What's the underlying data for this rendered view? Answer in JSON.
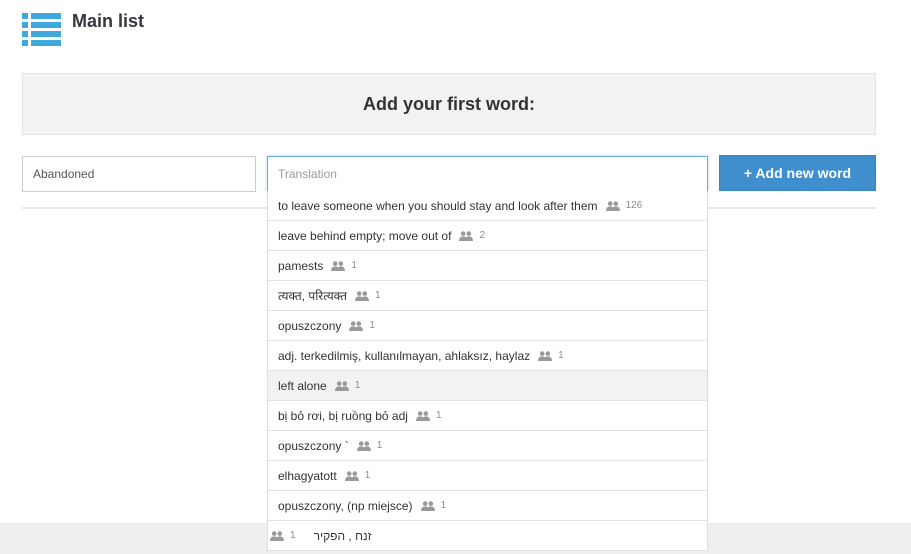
{
  "header": {
    "title": "Main list",
    "icon": "list-icon"
  },
  "add_panel": {
    "heading": "Add your first word:"
  },
  "form": {
    "word_value": "Abandoned",
    "translation_value": "",
    "translation_placeholder": "Translation",
    "add_button_label": "+ Add new word"
  },
  "suggestions": [
    {
      "text": "to leave someone when you should stay and look after them",
      "count": "126",
      "icon": "users-icon"
    },
    {
      "text": "leave behind empty; move out of",
      "count": "2",
      "icon": "users-icon"
    },
    {
      "text": "pamests",
      "count": "1",
      "icon": "users-icon"
    },
    {
      "text": "त्यक्त, परित्यक्त",
      "count": "1",
      "icon": "users-icon"
    },
    {
      "text": "opuszczony",
      "count": "1",
      "icon": "users-icon"
    },
    {
      "text": "adj. terkedilmiş, kullanılmayan, ahlaksız, haylaz",
      "count": "1",
      "icon": "users-icon"
    },
    {
      "text": "left alone",
      "count": "1",
      "icon": "users-icon",
      "highlighted": true
    },
    {
      "text": "bị bỏ rơi, bị ruồng bỏ adj",
      "count": "1",
      "icon": "users-icon"
    },
    {
      "text": "opuszczony `",
      "count": "1",
      "icon": "users-icon"
    },
    {
      "text": "elhagyatott",
      "count": "1",
      "icon": "users-icon"
    },
    {
      "text": "opuszczony, (np miejsce)",
      "count": "1",
      "icon": "users-icon"
    },
    {
      "text": "זנח , הפקיר",
      "count": "1",
      "icon": "users-icon",
      "rtl": true
    }
  ],
  "colors": {
    "accent": "#3f8fcf",
    "icon_blue": "#3fa9dd",
    "focus_border": "#66afe9",
    "panel_bg": "#f2f2f2",
    "highlight_bg": "#f2f2f2",
    "count_gray": "#8d8d8d"
  }
}
